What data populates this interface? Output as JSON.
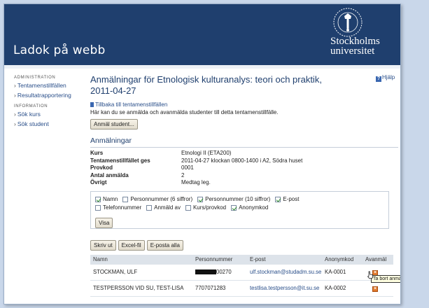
{
  "app": {
    "title": "Ladok på webb",
    "logo_line1": "Stockholms",
    "logo_line2": "universitet"
  },
  "sidebar": {
    "admin_heading": "ADMINISTRATION",
    "items_admin": [
      {
        "label": "Tentamenstillfällen"
      },
      {
        "label": "Resultatrapportering"
      }
    ],
    "info_heading": "INFORMATION",
    "items_info": [
      {
        "label": "Sök kurs"
      },
      {
        "label": "Sök student"
      }
    ]
  },
  "main": {
    "title": "Anmälningar för Etnologisk kulturanalys: teori och praktik, 2011-04-27",
    "help_label": "Hjälp",
    "back_link": "Tillbaka till tentamenstillfällen",
    "intro": "Här kan du se anmälda och avanmälda studenter till detta tentamenstillfälle.",
    "register_button": "Anmäl student...",
    "section_title": "Anmälningar",
    "details": [
      {
        "key": "Kurs",
        "value": "Etnologi II (ETA200)"
      },
      {
        "key": "Tentamenstillfället ges",
        "value": "2011-04-27 klockan 0800-1400 i A2, Södra huset"
      },
      {
        "key": "Provkod",
        "value": "0001"
      },
      {
        "key": "Antal anmälda",
        "value": "2"
      },
      {
        "key": "Övrigt",
        "value": "Medtag leg."
      }
    ]
  },
  "filters": {
    "options": [
      {
        "label": "Namn",
        "checked": true
      },
      {
        "label": "Personnummer (6 siffror)",
        "checked": false
      },
      {
        "label": "Personnummer (10 siffror)",
        "checked": true
      },
      {
        "label": "E-post",
        "checked": true
      },
      {
        "label": "Telefonnummer",
        "checked": false
      },
      {
        "label": "Anmäld av",
        "checked": false
      },
      {
        "label": "Kurs/provkod",
        "checked": false
      },
      {
        "label": "Anonymkod",
        "checked": true
      }
    ],
    "show_button": "Visa"
  },
  "actions": {
    "print": "Skriv ut",
    "excel": "Excel-fil",
    "email_all": "E-posta alla"
  },
  "table": {
    "headers": {
      "name": "Namn",
      "pnr": "Personnummer",
      "email": "E-post",
      "anon": "Anonymkod",
      "unregister": "Avanmäl"
    },
    "rows": [
      {
        "name": "STOCKMAN, ULF",
        "pnr_suffix": "00270",
        "email": "ulf.stockman@studadm.su.se",
        "anon": "KA-0001"
      },
      {
        "name": "TESTPERSSON VID SU, TEST-LISA",
        "pnr": "7707071283",
        "email": "testlisa.testpersson@it.su.se",
        "anon": "KA-0002"
      }
    ],
    "tooltip": "Ta bort anmäld student"
  },
  "colors": {
    "header_bg": "#1f3f6e",
    "link": "#2a4f8a",
    "delete_icon": "#e0782a"
  }
}
